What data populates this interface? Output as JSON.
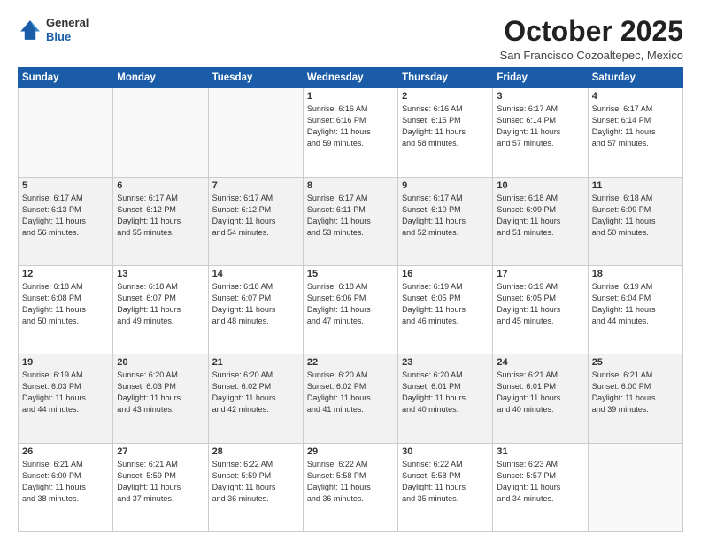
{
  "header": {
    "logo_general": "General",
    "logo_blue": "Blue",
    "month_title": "October 2025",
    "location": "San Francisco Cozoaltepec, Mexico"
  },
  "weekdays": [
    "Sunday",
    "Monday",
    "Tuesday",
    "Wednesday",
    "Thursday",
    "Friday",
    "Saturday"
  ],
  "weeks": [
    [
      {
        "day": "",
        "text": ""
      },
      {
        "day": "",
        "text": ""
      },
      {
        "day": "",
        "text": ""
      },
      {
        "day": "1",
        "text": "Sunrise: 6:16 AM\nSunset: 6:16 PM\nDaylight: 11 hours\nand 59 minutes."
      },
      {
        "day": "2",
        "text": "Sunrise: 6:16 AM\nSunset: 6:15 PM\nDaylight: 11 hours\nand 58 minutes."
      },
      {
        "day": "3",
        "text": "Sunrise: 6:17 AM\nSunset: 6:14 PM\nDaylight: 11 hours\nand 57 minutes."
      },
      {
        "day": "4",
        "text": "Sunrise: 6:17 AM\nSunset: 6:14 PM\nDaylight: 11 hours\nand 57 minutes."
      }
    ],
    [
      {
        "day": "5",
        "text": "Sunrise: 6:17 AM\nSunset: 6:13 PM\nDaylight: 11 hours\nand 56 minutes."
      },
      {
        "day": "6",
        "text": "Sunrise: 6:17 AM\nSunset: 6:12 PM\nDaylight: 11 hours\nand 55 minutes."
      },
      {
        "day": "7",
        "text": "Sunrise: 6:17 AM\nSunset: 6:12 PM\nDaylight: 11 hours\nand 54 minutes."
      },
      {
        "day": "8",
        "text": "Sunrise: 6:17 AM\nSunset: 6:11 PM\nDaylight: 11 hours\nand 53 minutes."
      },
      {
        "day": "9",
        "text": "Sunrise: 6:17 AM\nSunset: 6:10 PM\nDaylight: 11 hours\nand 52 minutes."
      },
      {
        "day": "10",
        "text": "Sunrise: 6:18 AM\nSunset: 6:09 PM\nDaylight: 11 hours\nand 51 minutes."
      },
      {
        "day": "11",
        "text": "Sunrise: 6:18 AM\nSunset: 6:09 PM\nDaylight: 11 hours\nand 50 minutes."
      }
    ],
    [
      {
        "day": "12",
        "text": "Sunrise: 6:18 AM\nSunset: 6:08 PM\nDaylight: 11 hours\nand 50 minutes."
      },
      {
        "day": "13",
        "text": "Sunrise: 6:18 AM\nSunset: 6:07 PM\nDaylight: 11 hours\nand 49 minutes."
      },
      {
        "day": "14",
        "text": "Sunrise: 6:18 AM\nSunset: 6:07 PM\nDaylight: 11 hours\nand 48 minutes."
      },
      {
        "day": "15",
        "text": "Sunrise: 6:18 AM\nSunset: 6:06 PM\nDaylight: 11 hours\nand 47 minutes."
      },
      {
        "day": "16",
        "text": "Sunrise: 6:19 AM\nSunset: 6:05 PM\nDaylight: 11 hours\nand 46 minutes."
      },
      {
        "day": "17",
        "text": "Sunrise: 6:19 AM\nSunset: 6:05 PM\nDaylight: 11 hours\nand 45 minutes."
      },
      {
        "day": "18",
        "text": "Sunrise: 6:19 AM\nSunset: 6:04 PM\nDaylight: 11 hours\nand 44 minutes."
      }
    ],
    [
      {
        "day": "19",
        "text": "Sunrise: 6:19 AM\nSunset: 6:03 PM\nDaylight: 11 hours\nand 44 minutes."
      },
      {
        "day": "20",
        "text": "Sunrise: 6:20 AM\nSunset: 6:03 PM\nDaylight: 11 hours\nand 43 minutes."
      },
      {
        "day": "21",
        "text": "Sunrise: 6:20 AM\nSunset: 6:02 PM\nDaylight: 11 hours\nand 42 minutes."
      },
      {
        "day": "22",
        "text": "Sunrise: 6:20 AM\nSunset: 6:02 PM\nDaylight: 11 hours\nand 41 minutes."
      },
      {
        "day": "23",
        "text": "Sunrise: 6:20 AM\nSunset: 6:01 PM\nDaylight: 11 hours\nand 40 minutes."
      },
      {
        "day": "24",
        "text": "Sunrise: 6:21 AM\nSunset: 6:01 PM\nDaylight: 11 hours\nand 40 minutes."
      },
      {
        "day": "25",
        "text": "Sunrise: 6:21 AM\nSunset: 6:00 PM\nDaylight: 11 hours\nand 39 minutes."
      }
    ],
    [
      {
        "day": "26",
        "text": "Sunrise: 6:21 AM\nSunset: 6:00 PM\nDaylight: 11 hours\nand 38 minutes."
      },
      {
        "day": "27",
        "text": "Sunrise: 6:21 AM\nSunset: 5:59 PM\nDaylight: 11 hours\nand 37 minutes."
      },
      {
        "day": "28",
        "text": "Sunrise: 6:22 AM\nSunset: 5:59 PM\nDaylight: 11 hours\nand 36 minutes."
      },
      {
        "day": "29",
        "text": "Sunrise: 6:22 AM\nSunset: 5:58 PM\nDaylight: 11 hours\nand 36 minutes."
      },
      {
        "day": "30",
        "text": "Sunrise: 6:22 AM\nSunset: 5:58 PM\nDaylight: 11 hours\nand 35 minutes."
      },
      {
        "day": "31",
        "text": "Sunrise: 6:23 AM\nSunset: 5:57 PM\nDaylight: 11 hours\nand 34 minutes."
      },
      {
        "day": "",
        "text": ""
      }
    ]
  ]
}
